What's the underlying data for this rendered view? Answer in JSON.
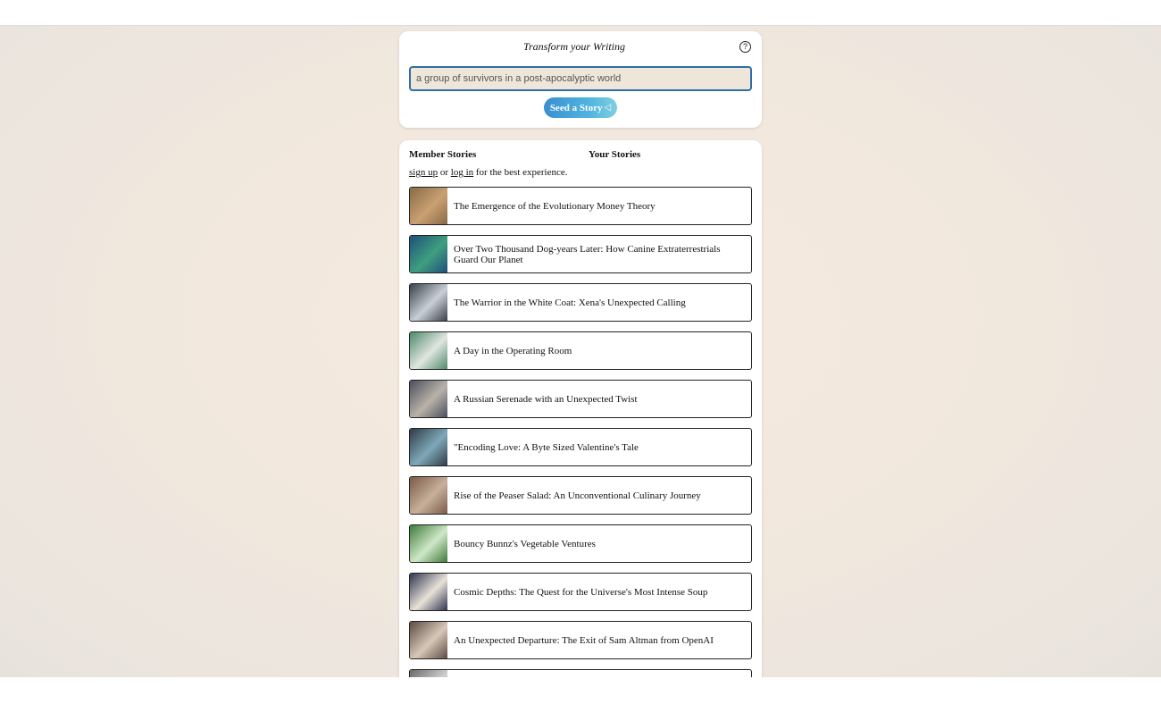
{
  "seed": {
    "title": "Transform your Writing",
    "help_icon": "?",
    "input_value": "a group of survivors in a post-apocalyptic world",
    "button_label": "Seed a Story",
    "button_icon": "✓"
  },
  "tabs": {
    "member": "Member Stories",
    "yours": "Your Stories"
  },
  "login": {
    "signup": "sign up",
    "or": "or",
    "login": "log in",
    "rest": "for the best experience."
  },
  "stories": [
    {
      "title": "The Emergence of the Evolutionary Money Theory",
      "c1": "#8a6a4a",
      "c2": "#c9a070"
    },
    {
      "title": "Over Two Thousand Dog-years Later: How Canine Extraterrestrials Guard Our Planet",
      "c1": "#1d4f7a",
      "c2": "#3f9f7e"
    },
    {
      "title": "The Warrior in the White Coat: Xena's Unexpected Calling",
      "c1": "#3a3f48",
      "c2": "#c8cfd6"
    },
    {
      "title": "A Day in the Operating Room",
      "c1": "#4f8a6a",
      "c2": "#dfe6e0"
    },
    {
      "title": "A Russian Serenade with an Unexpected Twist",
      "c1": "#4a4f5e",
      "c2": "#b9b2a8"
    },
    {
      "title": "\"Encoding Love: A Byte Sized Valentine's Tale",
      "c1": "#2e3a48",
      "c2": "#7fa8b8"
    },
    {
      "title": "Rise of the Peaser Salad: An Unconventional Culinary Journey",
      "c1": "#7a5a48",
      "c2": "#c8b09a"
    },
    {
      "title": "Bouncy Bunnz's Vegetable Ventures",
      "c1": "#3f7a3a",
      "c2": "#cfe8c8"
    },
    {
      "title": "Cosmic Depths: The Quest for the Universe's Most Intense Soup",
      "c1": "#2f3450",
      "c2": "#e8e2d8"
    },
    {
      "title": "An Unexpected Departure: The Exit of Sam Altman from OpenAI",
      "c1": "#5a4a42",
      "c2": "#d8c8b8"
    },
    {
      "title": "",
      "c1": "#6a6a6a",
      "c2": "#d0d0d0"
    }
  ]
}
